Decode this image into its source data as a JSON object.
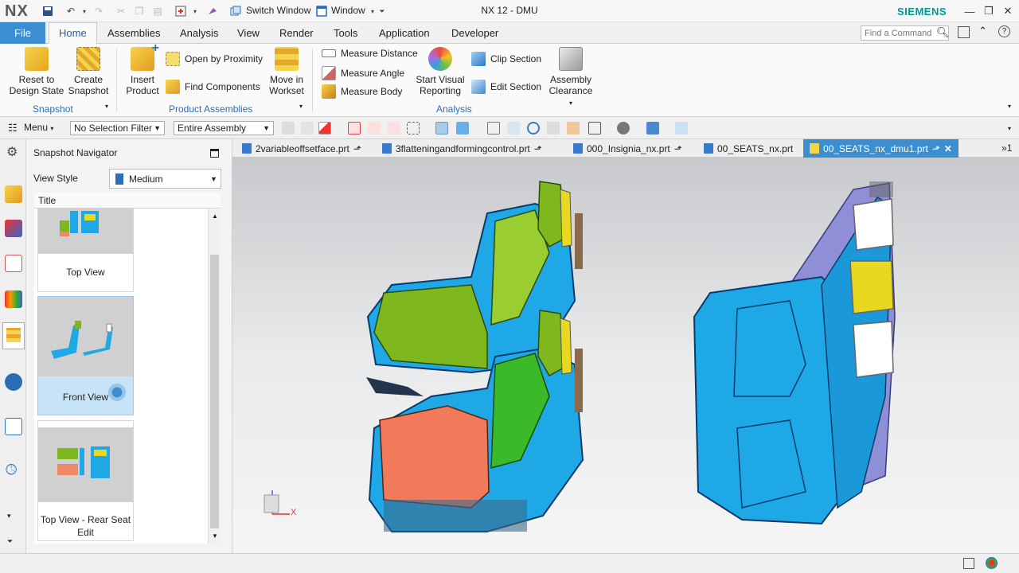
{
  "app": {
    "logo": "NX",
    "window_title": "NX 12 - DMU",
    "brand": "SIEMENS"
  },
  "quick_access": {
    "switch_window": "Switch Window",
    "window": "Window"
  },
  "menu_tabs": {
    "file": "File",
    "home": "Home",
    "assemblies": "Assemblies",
    "analysis": "Analysis",
    "view": "View",
    "render": "Render",
    "tools": "Tools",
    "application": "Application",
    "developer": "Developer"
  },
  "search": {
    "placeholder": "Find a Command"
  },
  "ribbon": {
    "snapshot": {
      "group": "Snapshot",
      "reset_1": "Reset to",
      "reset_2": "Design State",
      "create_1": "Create",
      "create_2": "Snapshot"
    },
    "product": {
      "group": "Product Assemblies",
      "insert_1": "Insert",
      "insert_2": "Product",
      "open_proximity": "Open by Proximity",
      "find_components": "Find Components",
      "move_1": "Move in",
      "move_2": "Workset"
    },
    "analysis": {
      "group": "Analysis",
      "measure_distance": "Measure Distance",
      "measure_angle": "Measure Angle",
      "measure_body": "Measure Body",
      "visual_1": "Start Visual",
      "visual_2": "Reporting",
      "clip_section": "Clip Section",
      "edit_section": "Edit Section",
      "clearance_1": "Assembly",
      "clearance_2": "Clearance"
    }
  },
  "toolbar": {
    "menu": "Menu",
    "selection_filter": "No Selection Filter",
    "scope": "Entire Assembly"
  },
  "navigator": {
    "title": "Snapshot Navigator",
    "view_style_label": "View Style",
    "view_style_value": "Medium",
    "column_title": "Title",
    "items": [
      {
        "label": "Top View"
      },
      {
        "label": "Front View"
      },
      {
        "label_1": "Top View - Rear Seat",
        "label_2": "Edit"
      }
    ]
  },
  "file_tabs": [
    {
      "label": "2variableoffsetface.prt"
    },
    {
      "label": "3flatteningandformingcontrol.prt"
    },
    {
      "label": "000_Insignia_nx.prt"
    },
    {
      "label": "00_SEATS_nx.prt"
    },
    {
      "label": "00_SEATS_nx_dmu1.prt"
    }
  ],
  "tab_overflow": "1",
  "triad": {
    "x": "X"
  },
  "colors": {
    "accent": "#3b8ed0",
    "group_label": "#2a6fb5",
    "siemens": "#009999",
    "seat_blue": "#1fa8e6",
    "seat_green": "#7fb81e",
    "seat_orange": "#f07a5a",
    "seat_yellow": "#e8d820",
    "seat_purple": "#8f8fd8"
  }
}
